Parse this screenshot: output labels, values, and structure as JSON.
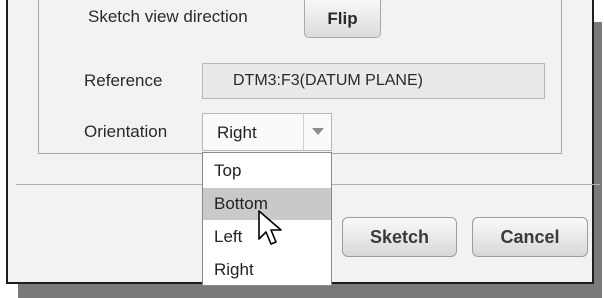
{
  "sketch_view": {
    "label": "Sketch view direction",
    "flip_button": "Flip"
  },
  "reference": {
    "label": "Reference",
    "value": "DTM3:F3(DATUM PLANE)"
  },
  "orientation": {
    "label": "Orientation",
    "selected": "Right",
    "options": [
      "Top",
      "Bottom",
      "Left",
      "Right"
    ],
    "hovered_option": "Bottom",
    "dropdown_open": true
  },
  "buttons": {
    "sketch": "Sketch",
    "cancel": "Cancel"
  },
  "icons": {
    "dropdown_arrow": "chevron-down-icon",
    "cursor": "mouse-pointer-icon"
  },
  "colors": {
    "dialog_background": "#f2f2f2",
    "highlight": "#c9c9c9",
    "text": "#2a2a2a"
  }
}
